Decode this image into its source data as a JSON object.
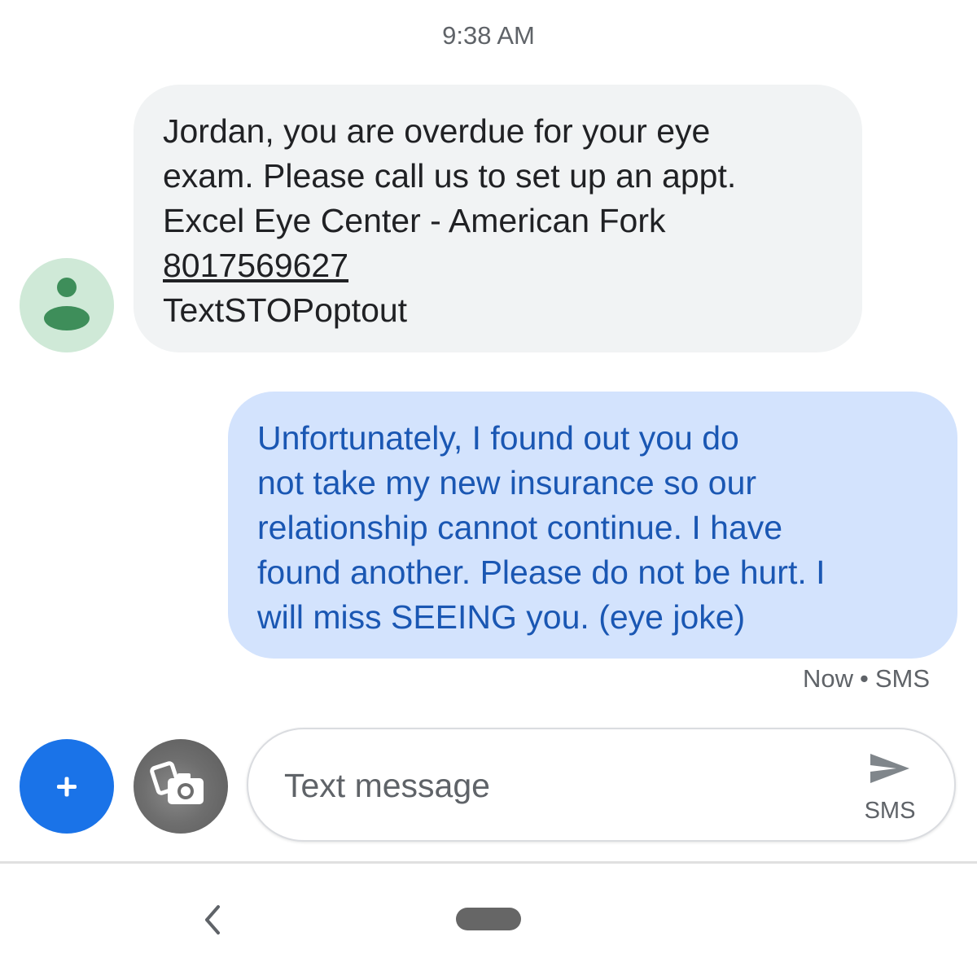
{
  "conversation": {
    "timestamp": "9:38 AM",
    "incoming": {
      "lines": [
        "Jordan, you are overdue for your eye",
        "exam. Please call us to set up an appt.",
        "Excel Eye Center - American Fork"
      ],
      "phone": "8017569627",
      "optout": "TextSTOPoptout"
    },
    "outgoing": {
      "lines": [
        "Unfortunately, I found out you do",
        "not take my new insurance so our",
        "relationship cannot continue. I have",
        "found another. Please do not be hurt. I",
        "will miss SEEING you. (eye joke)"
      ],
      "status_time": "Now",
      "status_separator": "•",
      "status_type": "SMS"
    }
  },
  "composer": {
    "placeholder": "Text message",
    "send_label": "SMS"
  },
  "icons": {
    "avatar": "person-icon",
    "add": "plus-icon",
    "camera": "camera-icon",
    "send": "send-icon",
    "back": "back-chevron-icon",
    "home": "home-pill-icon"
  },
  "colors": {
    "incoming_bubble": "#f1f3f4",
    "outgoing_bubble": "#d3e3fd",
    "outgoing_text": "#1a57b3",
    "accent_blue": "#1a73e8",
    "avatar_bg": "#cfe9d7",
    "avatar_fg": "#3e8e5a"
  }
}
